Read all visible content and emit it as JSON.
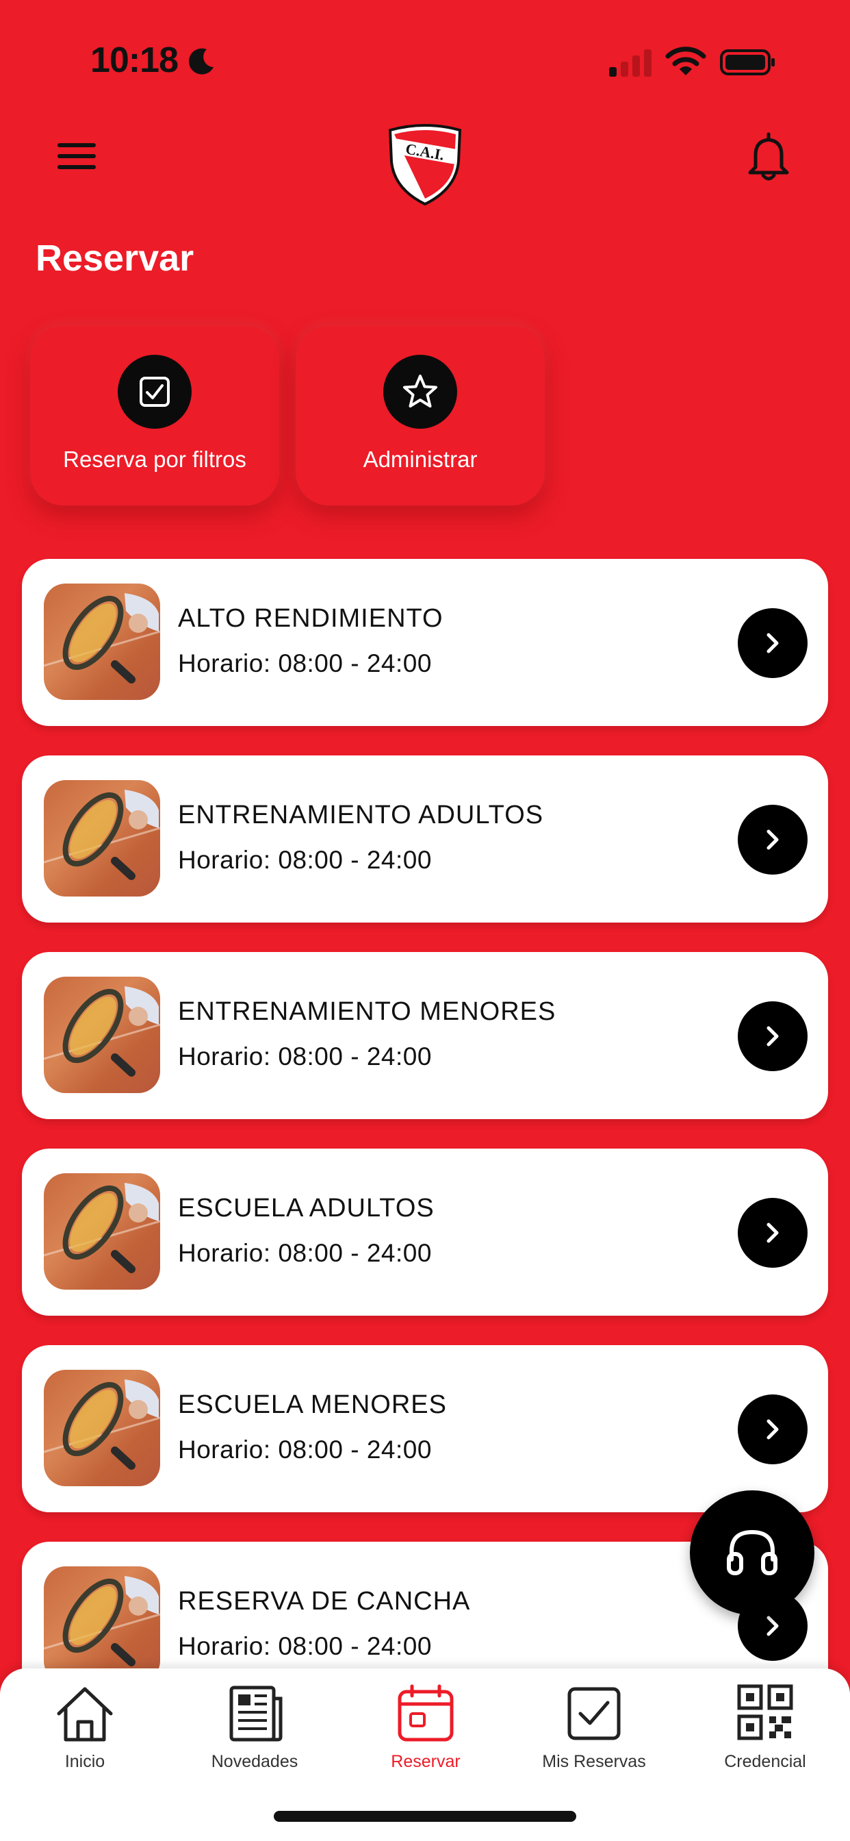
{
  "status_bar": {
    "time": "10:18"
  },
  "header": {
    "title": "Reservar",
    "logo_text": "C.A.I."
  },
  "quick_actions": [
    {
      "label": "Reserva por filtros",
      "icon": "checkbox-icon"
    },
    {
      "label": "Administrar",
      "icon": "star-icon"
    }
  ],
  "activities": [
    {
      "title": "ALTO RENDIMIENTO",
      "hours": "Horario: 08:00 - 24:00"
    },
    {
      "title": "ENTRENAMIENTO ADULTOS",
      "hours": "Horario: 08:00 - 24:00"
    },
    {
      "title": "ENTRENAMIENTO MENORES",
      "hours": "Horario: 08:00 - 24:00"
    },
    {
      "title": "ESCUELA ADULTOS",
      "hours": "Horario: 08:00 - 24:00"
    },
    {
      "title": "ESCUELA MENORES",
      "hours": "Horario: 08:00 - 24:00"
    },
    {
      "title": "RESERVA DE CANCHA",
      "hours": "Horario: 08:00 - 24:00"
    }
  ],
  "tab_bar": {
    "active": "Reservar",
    "items": [
      {
        "label": "Inicio",
        "icon": "home-icon"
      },
      {
        "label": "Novedades",
        "icon": "newspaper-icon"
      },
      {
        "label": "Reservar",
        "icon": "calendar-icon"
      },
      {
        "label": "Mis Reservas",
        "icon": "checkbox-icon"
      },
      {
        "label": "Credencial",
        "icon": "qr-code-icon"
      }
    ]
  },
  "colors": {
    "brand_red": "#ec1c28",
    "black": "#000000",
    "white": "#ffffff"
  }
}
